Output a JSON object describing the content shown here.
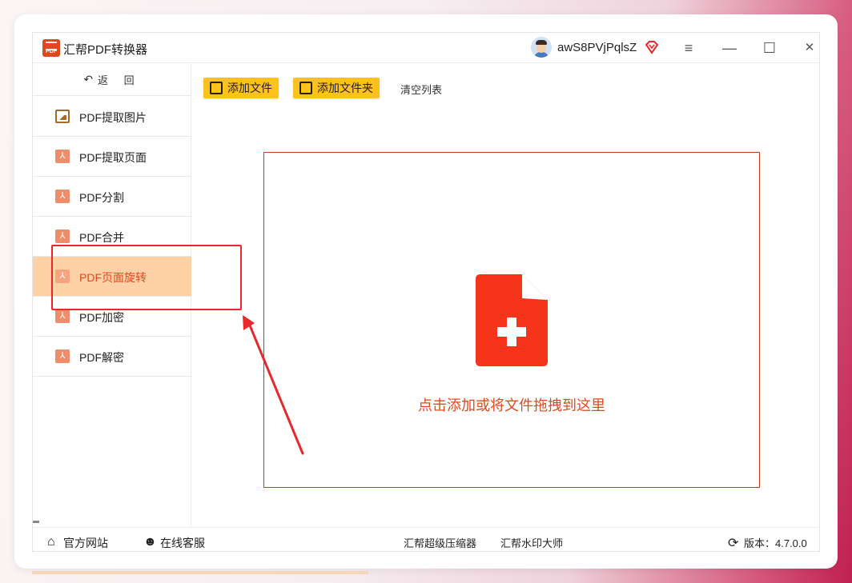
{
  "app": {
    "title": "汇帮PDF转换器",
    "logo_text": "PDF"
  },
  "user": {
    "name": "awS8PVjPqlsZ"
  },
  "window_controls": {
    "menu": "≡",
    "minimize": "—",
    "maximize": "☐",
    "close": "✕"
  },
  "sidebar": {
    "back_label": "返 回",
    "items": [
      {
        "label": "PDF提取图片",
        "icon": "image-icon",
        "active": false
      },
      {
        "label": "PDF提取页面",
        "icon": "pdf-icon",
        "active": false
      },
      {
        "label": "PDF分割",
        "icon": "pdf-icon",
        "active": false
      },
      {
        "label": "PDF合并",
        "icon": "pdf-icon",
        "active": false
      },
      {
        "label": "PDF页面旋转",
        "icon": "pdf-icon",
        "active": true
      },
      {
        "label": "PDF加密",
        "icon": "pdf-icon",
        "active": false
      },
      {
        "label": "PDF解密",
        "icon": "pdf-icon",
        "active": false
      }
    ]
  },
  "toolbar": {
    "add_file": "添加文件",
    "add_folder": "添加文件夹",
    "clear_list": "清空列表"
  },
  "dropzone": {
    "hint": "点击添加或将文件拖拽到这里"
  },
  "footer": {
    "official_site": "官方网站",
    "online_service": "在线客服",
    "compressor": "汇帮超级压缩器",
    "watermark": "汇帮水印大师",
    "version_label": "版本：4.7.0.0"
  },
  "colors": {
    "accent": "#e0491e",
    "button": "#ffc21a",
    "active_bg": "#ffd1a6",
    "annotation": "#e8282b"
  }
}
